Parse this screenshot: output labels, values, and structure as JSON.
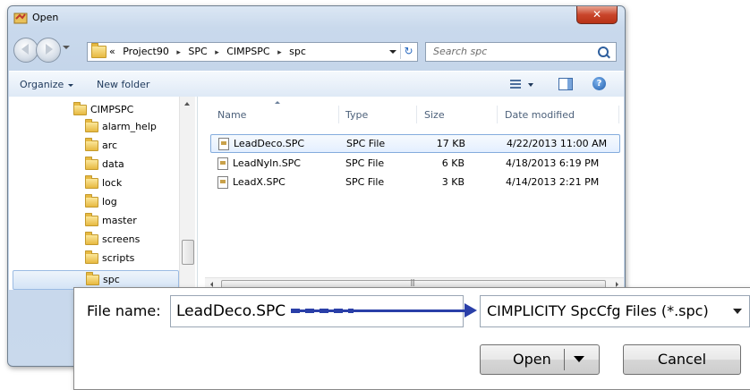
{
  "window": {
    "title": "Open",
    "close_glyph": "✕"
  },
  "address": {
    "crumbs": [
      "«",
      "Project90",
      "▸",
      "SPC",
      "▸",
      "CIMPSPC",
      "▸",
      "spc"
    ],
    "refresh_glyph": "↻"
  },
  "search": {
    "placeholder": "Search spc"
  },
  "toolbar": {
    "organize_label": "Organize",
    "new_folder_label": "New folder",
    "help_glyph": "?"
  },
  "nav_tree": [
    {
      "label": "CIMPSPC"
    },
    {
      "label": "alarm_help"
    },
    {
      "label": "arc"
    },
    {
      "label": "data"
    },
    {
      "label": "lock"
    },
    {
      "label": "log"
    },
    {
      "label": "master"
    },
    {
      "label": "screens"
    },
    {
      "label": "scripts"
    },
    {
      "label": "spc"
    }
  ],
  "columns": {
    "name": "Name",
    "type": "Type",
    "size": "Size",
    "date": "Date modified"
  },
  "files": [
    {
      "name": "LeadDeco.SPC",
      "type": "SPC File",
      "size": "17 KB",
      "date": "4/22/2013 11:00 AM"
    },
    {
      "name": "LeadNyln.SPC",
      "type": "SPC File",
      "size": "6 KB",
      "date": "4/18/2013 6:19 PM"
    },
    {
      "name": "LeadX.SPC",
      "type": "SPC File",
      "size": "3 KB",
      "date": "4/14/2013 2:21 PM"
    }
  ],
  "hscroll_grip": "|||",
  "footer": {
    "file_name_label": "File name:",
    "file_name_value": "LeadDeco.SPC",
    "file_type_value": "CIMPLICITY SpcCfg Files (*.spc)",
    "open_label": "Open",
    "cancel_label": "Cancel"
  },
  "colors": {
    "accent_arrow": "#2a3fa8",
    "close_button": "#c9452b",
    "selection": "#d4e4f6"
  }
}
